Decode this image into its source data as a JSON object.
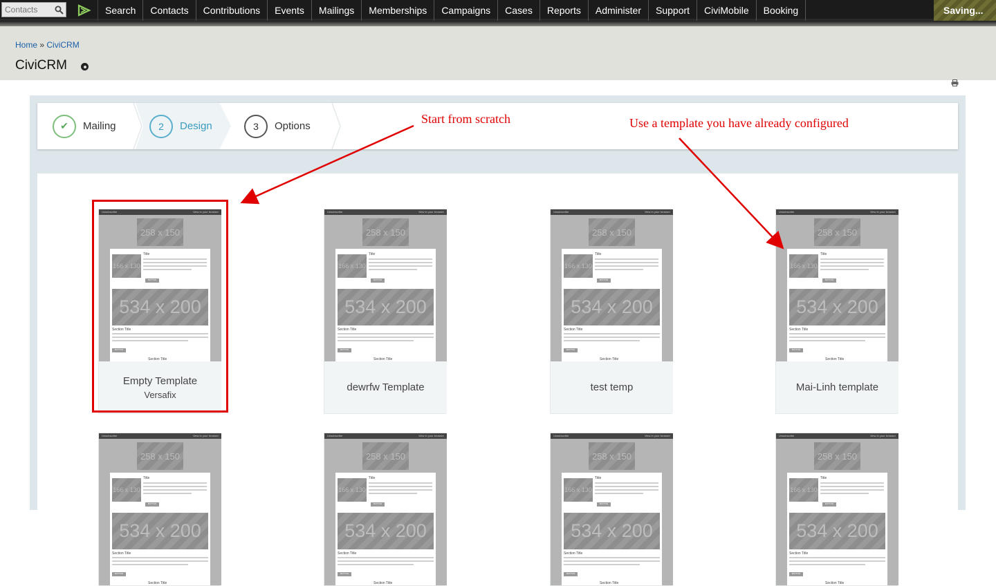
{
  "nav": {
    "search_placeholder": "Contacts",
    "items": [
      "Search",
      "Contacts",
      "Contributions",
      "Events",
      "Mailings",
      "Memberships",
      "Campaigns",
      "Cases",
      "Reports",
      "Administer",
      "Support",
      "CiviMobile",
      "Booking"
    ],
    "status": "Saving..."
  },
  "breadcrumb": {
    "home": "Home",
    "sep": "»",
    "current": "CiviCRM"
  },
  "page_title": "CiviCRM",
  "wizard": {
    "steps": [
      {
        "num": "✔",
        "label": "Mailing"
      },
      {
        "num": "2",
        "label": "Design"
      },
      {
        "num": "3",
        "label": "Options"
      }
    ]
  },
  "annotations": {
    "scratch": "Start from scratch",
    "configured": "Use a template you have already configured"
  },
  "thumb_text": {
    "unsubscribe": "Unsubscribe",
    "view_browser": "View in your browser",
    "ph_small": "258 x 150",
    "ph_side": "166 x 130",
    "ph_big": "534 x 200",
    "title": "Title",
    "section_title": "Section Title",
    "button": "BUTTON"
  },
  "templates": [
    {
      "name": "Empty Template",
      "sub": "Versafix"
    },
    {
      "name": "dewrfw Template",
      "sub": ""
    },
    {
      "name": "test temp",
      "sub": ""
    },
    {
      "name": "Mai-Linh template",
      "sub": ""
    }
  ]
}
